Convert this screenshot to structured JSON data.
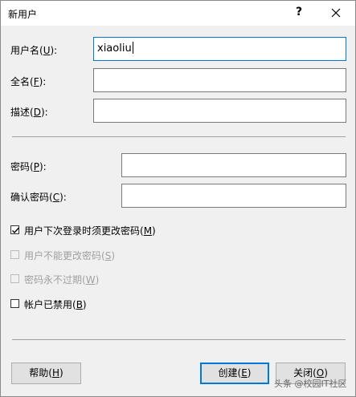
{
  "dialog": {
    "title": "新用户",
    "help_symbol": "?"
  },
  "fields": {
    "username": {
      "label": "用户名(",
      "key": "U",
      "end": "):",
      "value": "xiaoliu"
    },
    "fullname": {
      "label": "全名(",
      "key": "F",
      "end": "):",
      "value": ""
    },
    "description": {
      "label": "描述(",
      "key": "D",
      "end": "):",
      "value": ""
    },
    "password": {
      "label": "密码(",
      "key": "P",
      "end": "):",
      "value": ""
    },
    "confirm": {
      "label": "确认密码(",
      "key": "C",
      "end": "):",
      "value": ""
    }
  },
  "options": [
    {
      "label": "用户下次登录时须更改密码(",
      "key": "M",
      "end": ")",
      "checked": true,
      "enabled": true
    },
    {
      "label": "用户不能更改密码(",
      "key": "S",
      "end": ")",
      "checked": false,
      "enabled": false
    },
    {
      "label": "密码永不过期(",
      "key": "W",
      "end": ")",
      "checked": false,
      "enabled": false
    },
    {
      "label": "帐户已禁用(",
      "key": "B",
      "end": ")",
      "checked": false,
      "enabled": true
    }
  ],
  "buttons": {
    "help": {
      "label": "帮助(",
      "key": "H",
      "end": ")"
    },
    "create": {
      "label": "创建(",
      "key": "E",
      "end": ")"
    },
    "close": {
      "label": "关闭(",
      "key": "O",
      "end": ")"
    }
  },
  "watermark": "头条 @校园IT社区",
  "colors": {
    "accent": "#0078d7",
    "disabled_text": "#a0a0a0"
  }
}
